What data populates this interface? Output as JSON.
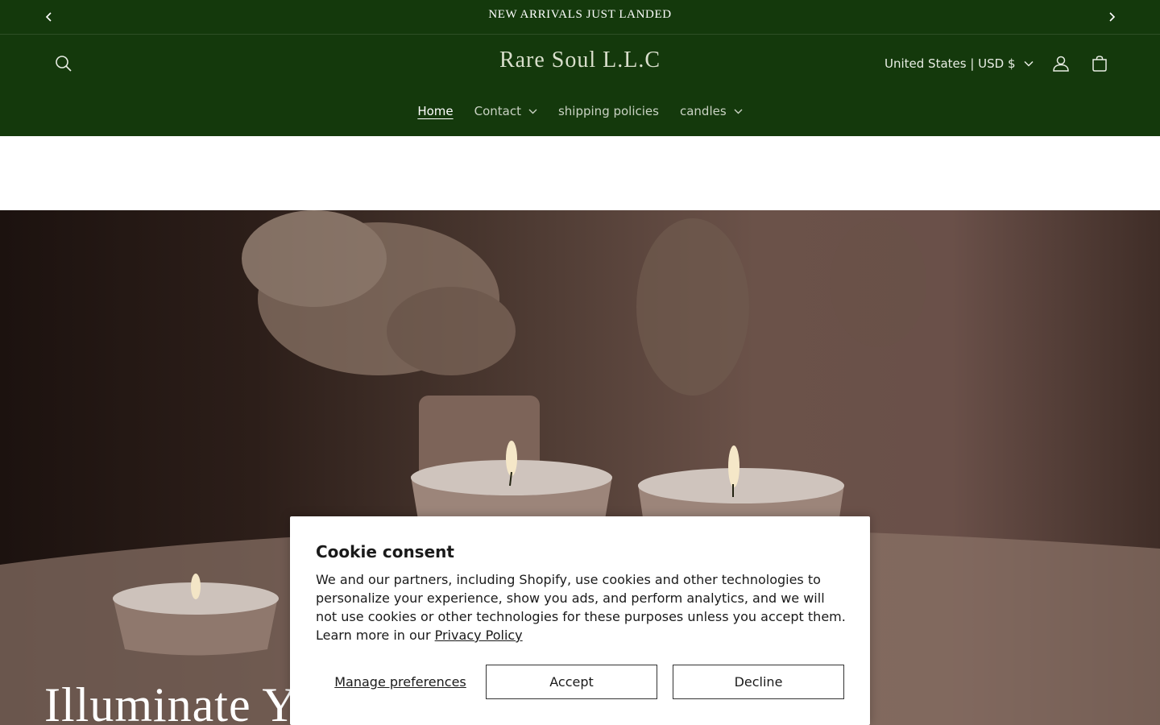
{
  "announcement": {
    "message": "NEW ARRIVALS JUST LANDED",
    "prev_icon": "chevron-left-icon",
    "next_icon": "chevron-right-icon"
  },
  "header": {
    "logo": "Rare Soul L.L.C",
    "country_selector": "United States | USD $",
    "icons": [
      "search-icon",
      "account-icon",
      "cart-icon"
    ],
    "nav": [
      {
        "label": "Home",
        "active": true,
        "dropdown": false
      },
      {
        "label": "Contact",
        "active": false,
        "dropdown": true
      },
      {
        "label": "shipping policies",
        "active": false,
        "dropdown": false
      },
      {
        "label": "candles",
        "active": false,
        "dropdown": true
      }
    ]
  },
  "hero": {
    "title": "Illuminate Y"
  },
  "cookie": {
    "title": "Cookie consent",
    "body": "We and our partners, including Shopify, use cookies and other technologies to personalize your experience, show you ads, and perform analytics, and we will not use cookies or other technologies for these purposes unless you accept them. Learn more in our ",
    "link": "Privacy Policy",
    "manage": "Manage preferences",
    "accept": "Accept",
    "decline": "Decline"
  },
  "colors": {
    "header_bg": "#14390c",
    "logo": "#d9dfcc",
    "cookie_bg": "#ffffff"
  }
}
